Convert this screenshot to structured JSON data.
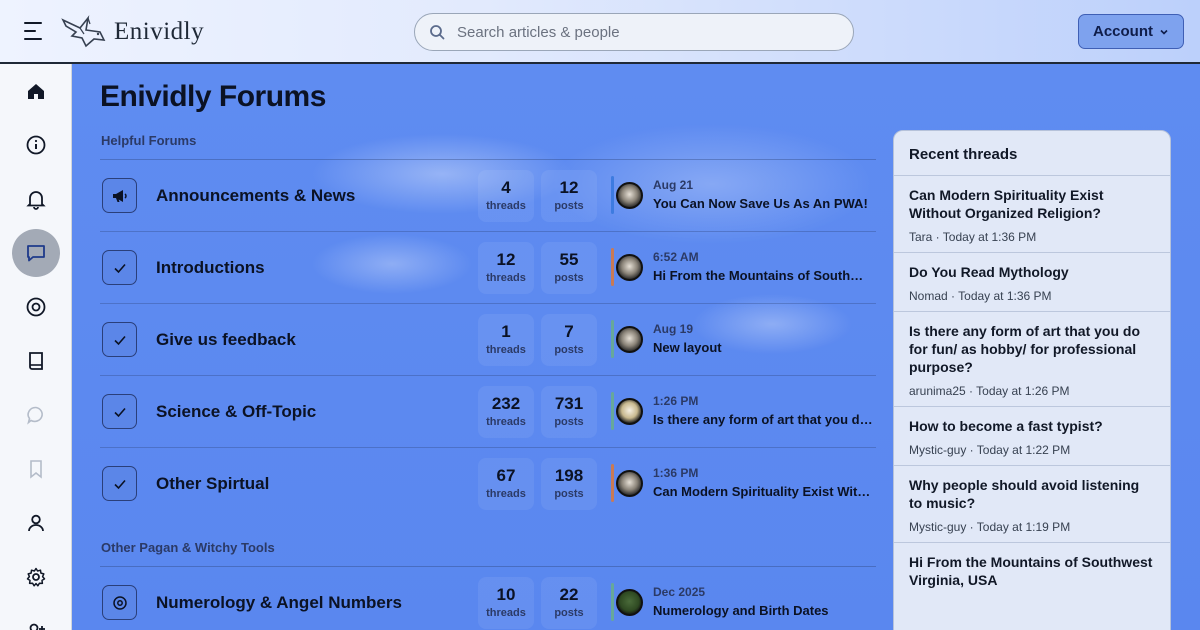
{
  "header": {
    "brand": "Enividly",
    "search_placeholder": "Search articles & people",
    "account_label": "Account"
  },
  "rail": {
    "items": [
      "home-icon",
      "info-icon",
      "bell-icon",
      "chat-icon",
      "lifebuoy-icon",
      "book-icon",
      "comment-icon",
      "bookmark-icon",
      "user-icon",
      "gear-icon",
      "user-plus-icon"
    ],
    "active": "chat-icon"
  },
  "main": {
    "title": "Enividly Forums",
    "sections": [
      {
        "label": "Helpful Forums"
      },
      {
        "label": "Other Pagan & Witchy Tools"
      }
    ],
    "forums": [
      {
        "title": "Announcements & News",
        "icon": "megaphone-icon",
        "threads": "4",
        "posts": "12",
        "threads_label": "threads",
        "posts_label": "posts",
        "latest_date": "Aug 21",
        "latest_title": "You Can Now Save Us As An PWA!",
        "bar_color": "#3d7be0"
      },
      {
        "title": "Introductions",
        "icon": "check-icon",
        "threads": "12",
        "posts": "55",
        "threads_label": "threads",
        "posts_label": "posts",
        "latest_date": "6:52 AM",
        "latest_title": "Hi From the Mountains of Southwest Virginia, USA",
        "bar_color": "#c97a55"
      },
      {
        "title": "Give us feedback",
        "icon": "check-icon",
        "threads": "1",
        "posts": "7",
        "threads_label": "threads",
        "posts_label": "posts",
        "latest_date": "Aug 19",
        "latest_title": "New layout",
        "bar_color": "#67a89a"
      },
      {
        "title": "Science & Off-Topic",
        "icon": "check-icon",
        "threads": "232",
        "posts": "731",
        "threads_label": "threads",
        "posts_label": "posts",
        "latest_date": "1:26 PM",
        "latest_title": "Is there any form of art that you do for fun",
        "bar_color": "#67a89a"
      },
      {
        "title": "Other Spirtual",
        "icon": "check-icon",
        "threads": "67",
        "posts": "198",
        "threads_label": "threads",
        "posts_label": "posts",
        "latest_date": "1:36 PM",
        "latest_title": "Can Modern Spirituality Exist Without Organized Religion?",
        "bar_color": "#c97a55"
      },
      {
        "title": "Numerology & Angel Numbers",
        "icon": "target-icon",
        "threads": "10",
        "posts": "22",
        "threads_label": "threads",
        "posts_label": "posts",
        "latest_date": "Dec 2025",
        "latest_title": "Numerology and Birth Dates",
        "bar_color": "#67a89a"
      }
    ]
  },
  "recent": {
    "heading": "Recent threads",
    "threads": [
      {
        "title": "Can Modern Spirituality Exist Without Organized Religion?",
        "author": "Tara",
        "time": "Today at 1:36 PM"
      },
      {
        "title": "Do You Read Mythology",
        "author": "Nomad",
        "time": "Today at 1:36 PM"
      },
      {
        "title": "Is there any form of art that you do for fun/ as hobby/ for professional purpose?",
        "author": "arunima25",
        "time": "Today at 1:26 PM"
      },
      {
        "title": "How to become a fast typist?",
        "author": "Mystic-guy",
        "time": "Today at 1:22 PM"
      },
      {
        "title": "Why people should avoid listening to music?",
        "author": "Mystic-guy",
        "time": "Today at 1:19 PM"
      },
      {
        "title": "Hi From the Mountains of Southwest Virginia, USA",
        "author": "",
        "time": ""
      }
    ]
  }
}
